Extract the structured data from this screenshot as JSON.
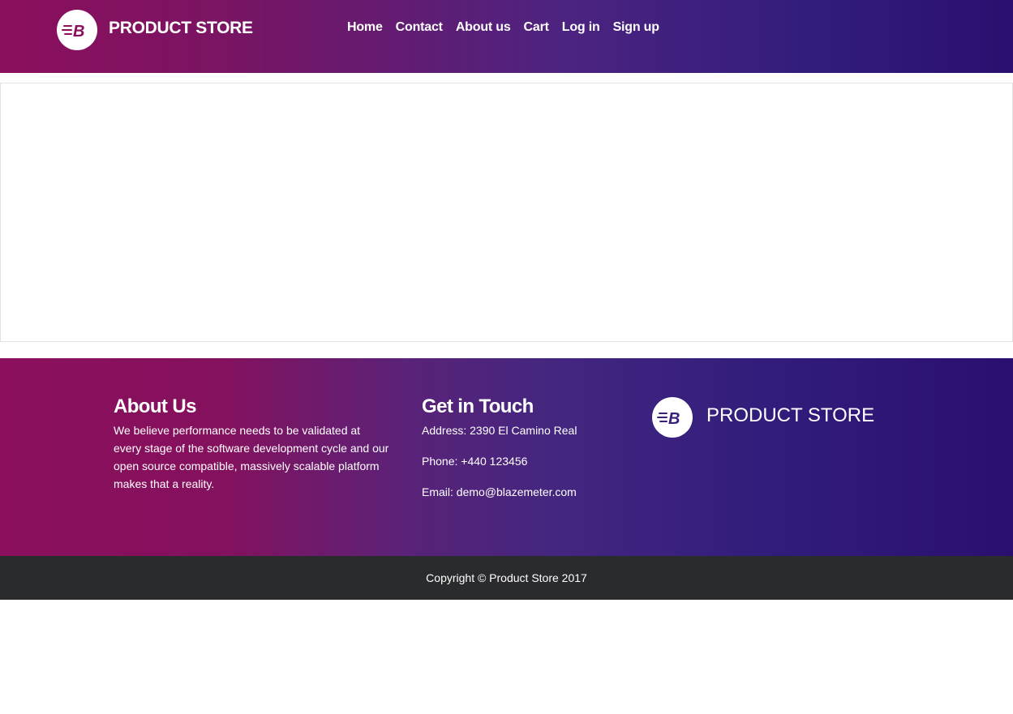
{
  "navbar": {
    "brand": "PRODUCT STORE",
    "logo_icon": "blazemeter-b-logo",
    "links": [
      {
        "label": "Home"
      },
      {
        "label": "Contact"
      },
      {
        "label": "About us"
      },
      {
        "label": "Cart"
      },
      {
        "label": "Log in"
      },
      {
        "label": "Sign up"
      }
    ]
  },
  "footer": {
    "about": {
      "heading": "About Us",
      "text": "We believe performance needs to be validated at every stage of the software development cycle and our open source compatible, massively scalable platform makes that a reality."
    },
    "touch": {
      "heading": "Get in Touch",
      "address": "Address: 2390 El Camino Real",
      "phone": "Phone: +440 123456",
      "email": "Email: demo@blazemeter.com"
    },
    "brand": "PRODUCT STORE"
  },
  "copyright": "Copyright © Product Store 2017",
  "colors": {
    "gradient_start": "#8b0f5c",
    "gradient_end": "#2a0f6f",
    "copyright_bg": "#2a2b2d"
  }
}
